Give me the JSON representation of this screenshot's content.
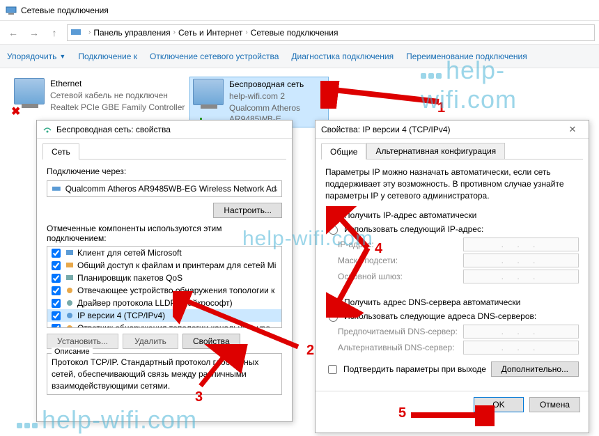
{
  "window": {
    "title": "Сетевые подключения"
  },
  "breadcrumb": {
    "a": "Панель управления",
    "b": "Сеть и Интернет",
    "c": "Сетевые подключения"
  },
  "toolbar": {
    "organize": "Упорядочить",
    "connect": "Подключение к",
    "disable": "Отключение сетевого устройства",
    "diag": "Диагностика подключения",
    "rename": "Переименование подключения"
  },
  "conn1": {
    "name": "Ethernet",
    "status": "Сетевой кабель не подключен",
    "device": "Realtek PCIe GBE Family Controller"
  },
  "conn2": {
    "name": "Беспроводная сеть",
    "status": "help-wifi.com  2",
    "device": "Qualcomm Atheros AR9485WB-E..."
  },
  "dlg1": {
    "title": "Беспроводная сеть: свойства",
    "tab": "Сеть",
    "conn_through": "Подключение через:",
    "adapter": "Qualcomm Atheros AR9485WB-EG Wireless Network Ada",
    "configure": "Настроить...",
    "components_label": "Отмеченные компоненты используются этим подключением:",
    "comps": [
      "Клиент для сетей Microsoft",
      "Общий доступ к файлам и принтерам для сетей Mi",
      "Планировщик пакетов QoS",
      "Отвечающее устройство обнаружения топологии к",
      "Драйвер протокола LLDP (Майкрософт)",
      "IP версии 4 (TCP/IPv4)",
      "Ответчик обнаружения топологии канального уро"
    ],
    "install": "Установить...",
    "remove": "Удалить",
    "props": "Свойства",
    "desc_legend": "Описание",
    "desc": "Протокол TCP/IP. Стандартный протокол глобальных сетей, обеспечивающий связь между различными взаимодействующими сетями."
  },
  "dlg2": {
    "title": "Свойства: IP версии 4 (TCP/IPv4)",
    "tab1": "Общие",
    "tab2": "Альтернативная конфигурация",
    "intro": "Параметры IP можно назначать автоматически, если сеть поддерживает эту возможность. В противном случае узнайте параметры IP у сетевого администратора.",
    "r1": "Получить IP-адрес автоматически",
    "r2": "Использовать следующий IP-адрес:",
    "ip": "IP-адрес:",
    "mask": "Маска подсети:",
    "gw": "Основной шлюз:",
    "r3": "Получить адрес DNS-сервера автоматически",
    "r4": "Использовать следующие адреса DNS-серверов:",
    "dns1": "Предпочитаемый DNS-сервер:",
    "dns2": "Альтернативный DNS-сервер:",
    "confirm": "Подтвердить параметры при выходе",
    "advanced": "Дополнительно...",
    "ok": "OK",
    "cancel": "Отмена"
  },
  "watermark": "help-wifi.com",
  "nums": {
    "n1": "1",
    "n2": "2",
    "n3": "3",
    "n4": "4",
    "n5": "5"
  }
}
